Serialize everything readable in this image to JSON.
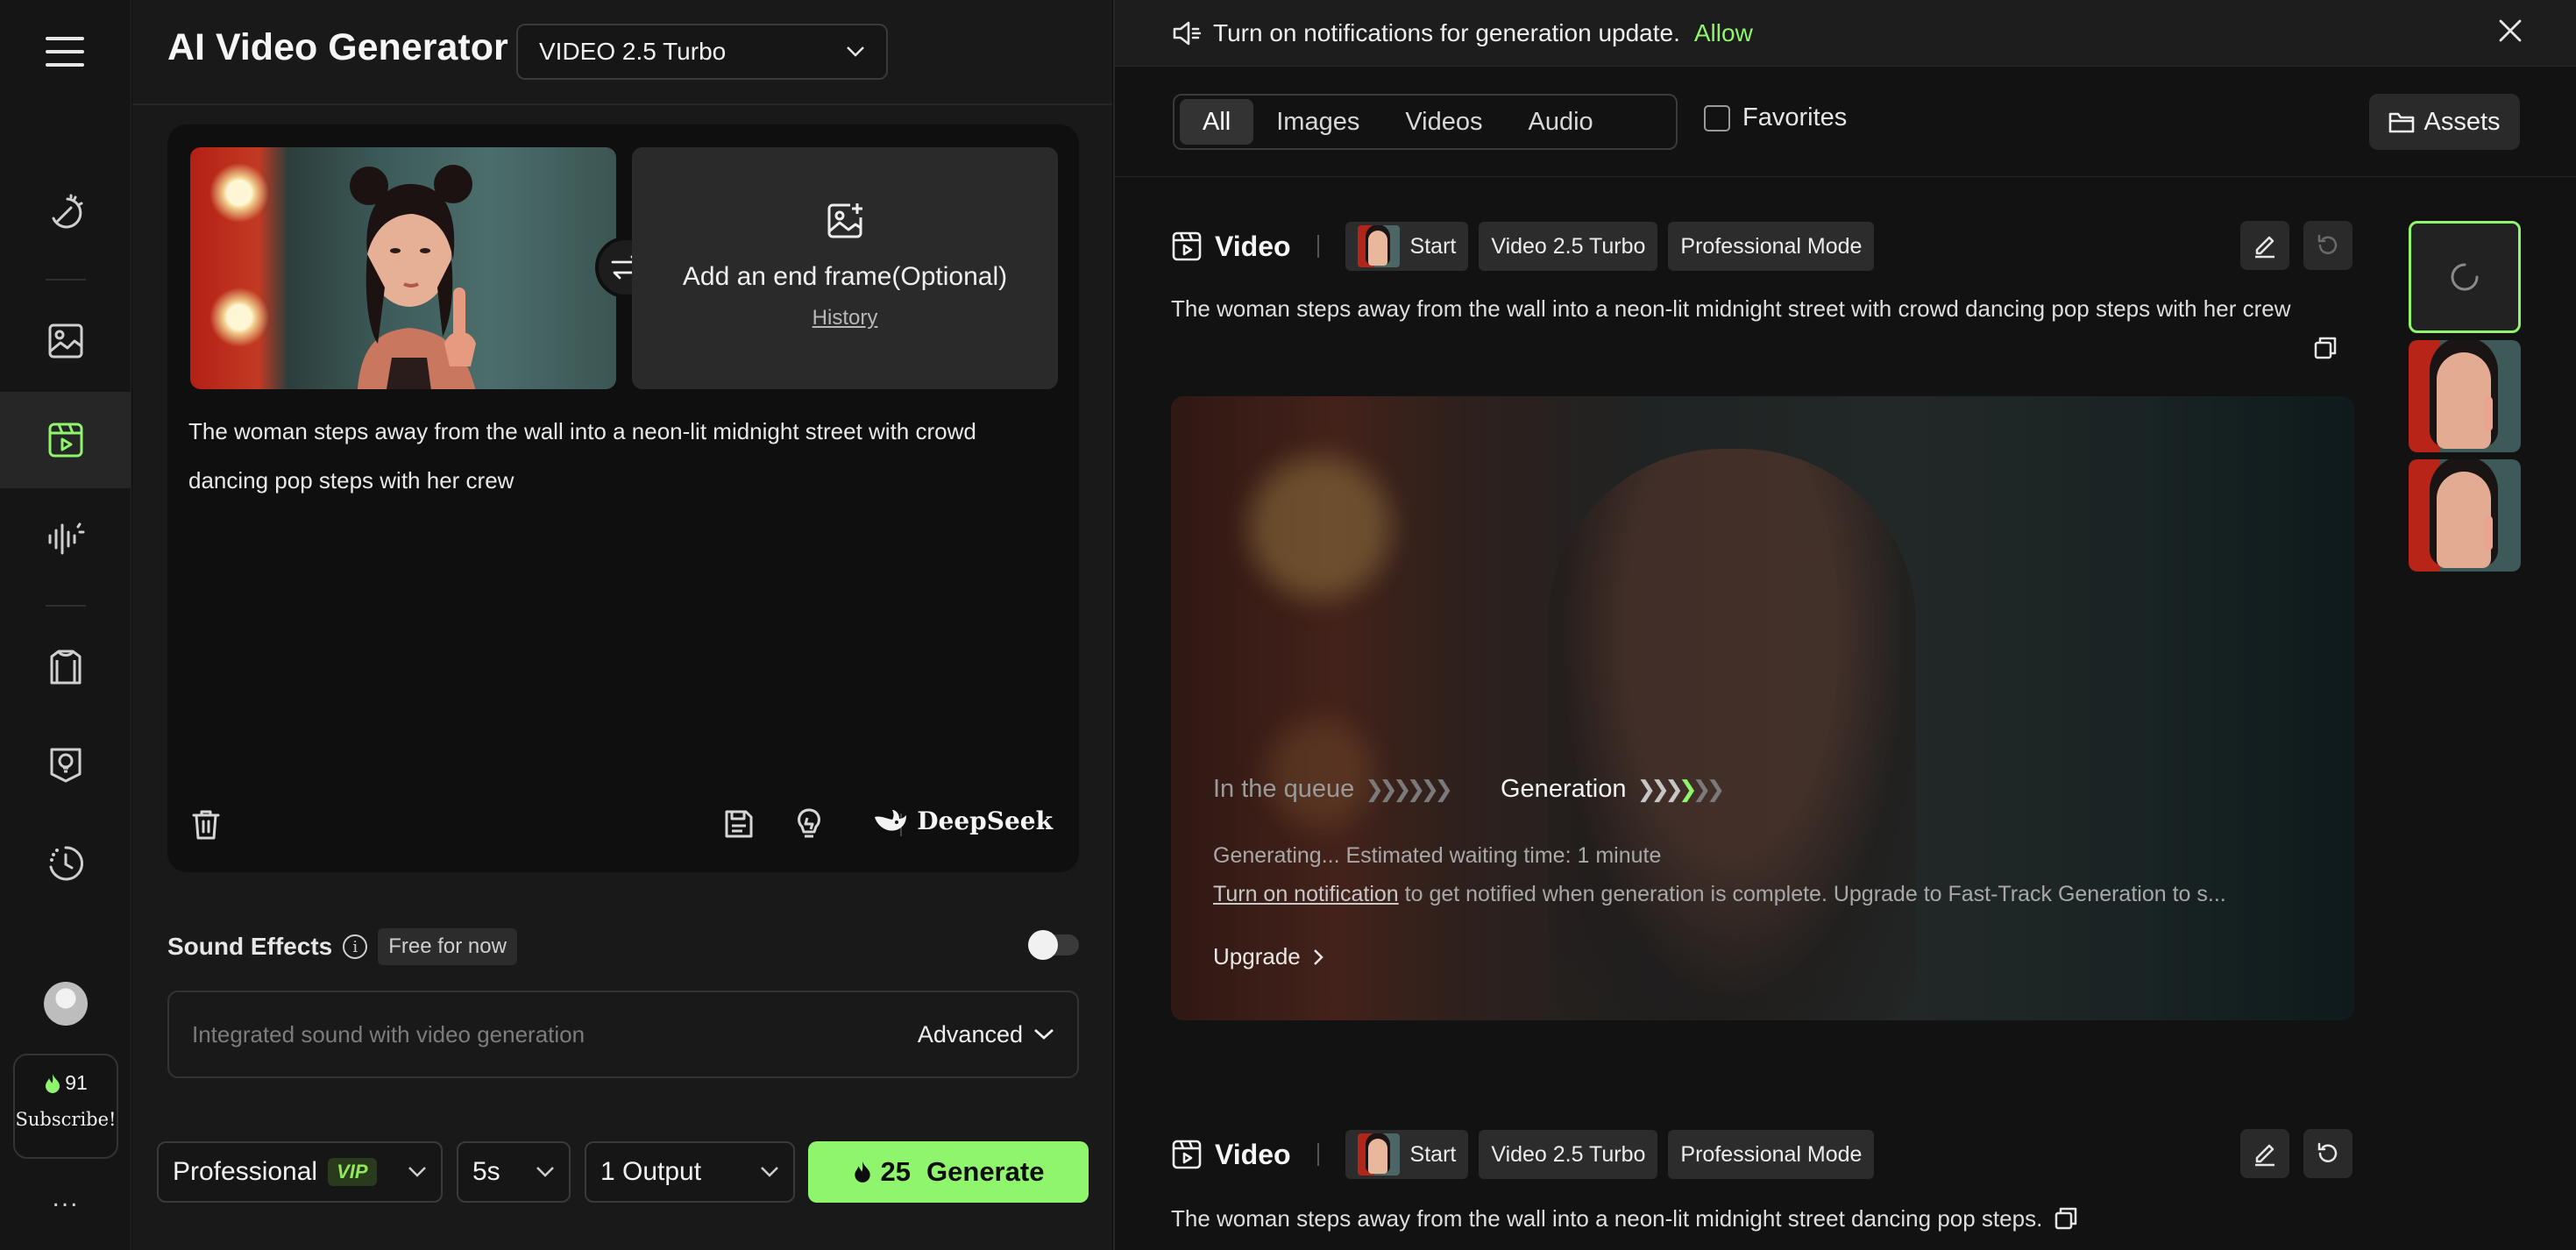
{
  "app": {
    "title": "AI Video Generator",
    "model": "VIDEO 2.5 Turbo"
  },
  "rail": {
    "credits": "91",
    "subscribe": "Subscribe!",
    "more": "..."
  },
  "editor": {
    "end_frame_label": "Add an end frame(Optional)",
    "history": "History",
    "prompt": "The woman steps away from the wall into a neon-lit midnight street with crowd dancing pop steps with her crew",
    "deepseek": "DeepSeek"
  },
  "sound": {
    "label": "Sound Effects",
    "badge": "Free for now",
    "placeholder": "Integrated sound with video generation",
    "advanced": "Advanced"
  },
  "bottom": {
    "mode": "Professional",
    "vip": "VIP",
    "duration": "5s",
    "outputs": "1 Output",
    "cost": "25",
    "generate": "Generate"
  },
  "notification": {
    "text": "Turn on notifications for generation update.",
    "allow": "Allow"
  },
  "filters": {
    "tabs": [
      "All",
      "Images",
      "Videos",
      "Audio"
    ],
    "active": "All",
    "favorites": "Favorites",
    "assets": "Assets"
  },
  "cards": [
    {
      "kind": "Video",
      "chips": [
        "Start",
        "Video 2.5 Turbo",
        "Professional Mode"
      ],
      "description": "The woman steps away from the wall into a neon-lit midnight street with crowd dancing pop steps with her crew",
      "status": {
        "queue": "In the queue",
        "generation": "Generation",
        "message": "Generating... Estimated waiting time: 1 minute",
        "notify_link": "Turn on notification",
        "notify_rest": " to get notified when generation is complete. Upgrade to Fast-Track Generation to s...",
        "upgrade": "Upgrade"
      }
    },
    {
      "kind": "Video",
      "chips": [
        "Start",
        "Video 2.5 Turbo",
        "Professional Mode"
      ],
      "description": "The woman steps away from the wall into a neon-lit midnight street dancing pop steps."
    }
  ],
  "colors": {
    "accent": "#8ff56c",
    "background": "#121212",
    "panel": "#191919"
  }
}
